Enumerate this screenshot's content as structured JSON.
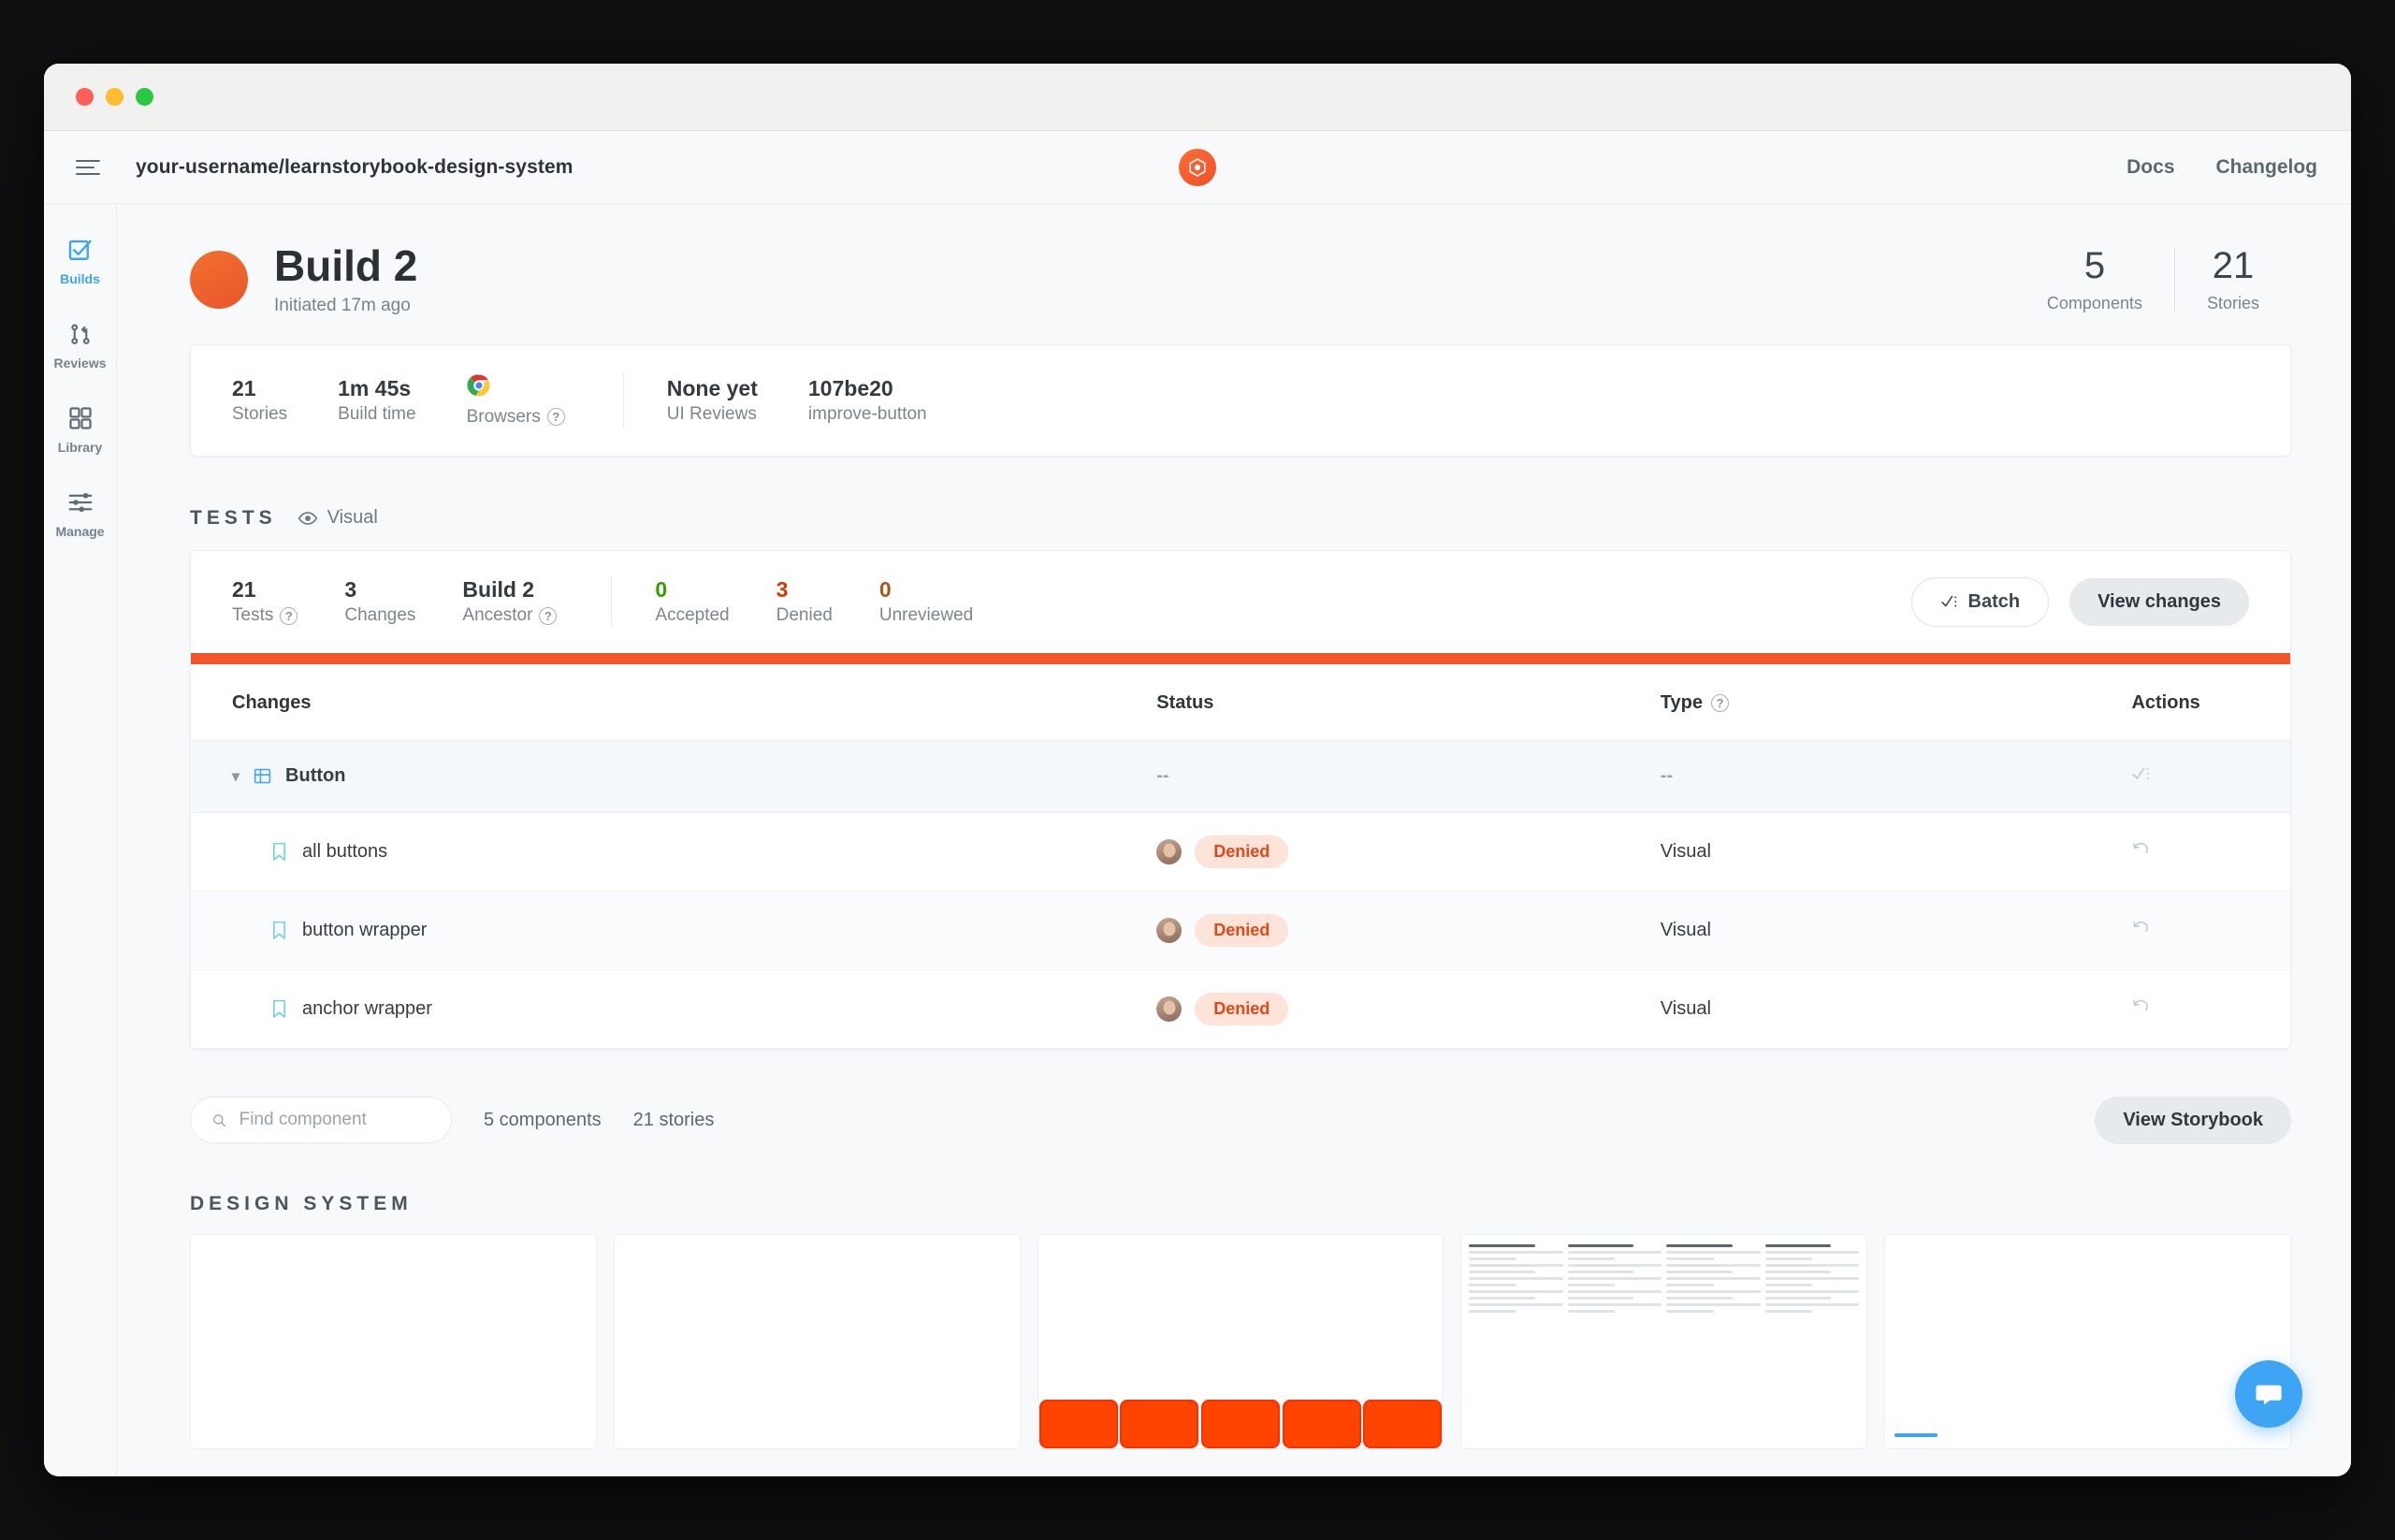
{
  "window": {
    "traffic_lights": [
      "close",
      "minimize",
      "maximize"
    ]
  },
  "header": {
    "menu_icon": "hamburger-menu-icon",
    "repo_path": "your-username/learnstorybook-design-system",
    "logo": "chromatic-logo-icon",
    "nav": [
      {
        "label": "Docs"
      },
      {
        "label": "Changelog"
      }
    ]
  },
  "sidebar": {
    "items": [
      {
        "label": "Builds",
        "icon": "checkbox-checked-icon",
        "active": true
      },
      {
        "label": "Reviews",
        "icon": "pull-request-icon",
        "active": false
      },
      {
        "label": "Library",
        "icon": "grid-squares-icon",
        "active": false
      },
      {
        "label": "Manage",
        "icon": "sliders-icon",
        "active": false
      }
    ]
  },
  "hero": {
    "title": "Build 2",
    "subtitle": "Initiated 17m ago",
    "avatar_color": "#f0512a",
    "counts": [
      {
        "value": "5",
        "label": "Components"
      },
      {
        "value": "21",
        "label": "Stories"
      }
    ]
  },
  "info_card": {
    "stats": [
      {
        "value": "21",
        "label": "Stories"
      },
      {
        "value": "1m 45s",
        "label": "Build time"
      },
      {
        "value": "",
        "label": "Browsers",
        "icon": "chrome-icon",
        "help": true
      },
      {
        "value": "None yet",
        "label": "UI Reviews"
      },
      {
        "value": "107be20",
        "label": "improve-button",
        "link": true
      }
    ]
  },
  "tests": {
    "section_label": "TESTS",
    "visual_tab": "Visual",
    "visual_icon": "eye-icon",
    "summary": [
      {
        "value": "21",
        "label": "Tests",
        "help": true,
        "color": "default"
      },
      {
        "value": "3",
        "label": "Changes",
        "help": false,
        "color": "default"
      },
      {
        "value": "Build 2",
        "label": "Ancestor",
        "help": true,
        "color": "link"
      },
      {
        "value": "0",
        "label": "Accepted",
        "help": false,
        "color": "green"
      },
      {
        "value": "3",
        "label": "Denied",
        "help": false,
        "color": "red"
      },
      {
        "value": "0",
        "label": "Unreviewed",
        "help": false,
        "color": "amber"
      }
    ],
    "batch_button": "Batch",
    "batch_icon": "checkmark-list-icon",
    "view_changes_button": "View changes",
    "accent_bar_color": "#f1562a",
    "table": {
      "columns": [
        "Changes",
        "Status",
        "Type",
        "Actions"
      ],
      "type_help": true,
      "rows": [
        {
          "kind": "component",
          "name": "Button",
          "icon": "component-icon",
          "chevron": "chevron-down-icon",
          "status": "--",
          "type": "--",
          "action_icon": "batch-check-icon"
        },
        {
          "kind": "story",
          "name": "all buttons",
          "icon": "bookmark-icon",
          "status": "Denied",
          "avatar": "user-avatar",
          "type": "Visual",
          "action_icon": "undo-icon"
        },
        {
          "kind": "story",
          "name": "button wrapper",
          "icon": "bookmark-icon",
          "status": "Denied",
          "avatar": "user-avatar",
          "type": "Visual",
          "action_icon": "undo-icon"
        },
        {
          "kind": "story",
          "name": "anchor wrapper",
          "icon": "bookmark-icon",
          "status": "Denied",
          "avatar": "user-avatar",
          "type": "Visual",
          "action_icon": "undo-icon"
        }
      ]
    }
  },
  "filter": {
    "search_placeholder": "Find component",
    "search_value": "",
    "search_icon": "search-icon",
    "components_count": "5 components",
    "stories_count": "21 stories",
    "view_storybook_button": "View Storybook"
  },
  "design_system": {
    "heading": "DESIGN SYSTEM"
  },
  "chat": {
    "icon": "chat-bubble-icon",
    "color": "#3da5f4"
  }
}
